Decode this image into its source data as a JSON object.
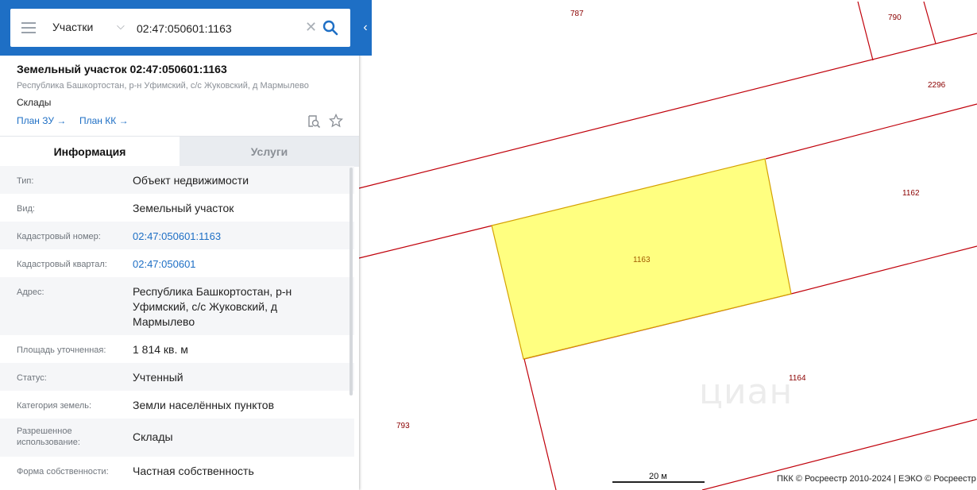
{
  "search": {
    "type_label": "Участки",
    "query": "02:47:050601:1163"
  },
  "object": {
    "title": "Земельный участок 02:47:050601:1163",
    "address": "Республика Башкортостан, р-н Уфимский, с/с Жуковский, д Мармылево",
    "use": "Склады",
    "plan_zu": "План ЗУ →",
    "plan_kk": "План КК →"
  },
  "tabs": {
    "info": "Информация",
    "services": "Услуги"
  },
  "info_rows": [
    {
      "label": "Тип:",
      "value": "Объект недвижимости"
    },
    {
      "label": "Вид:",
      "value": "Земельный участок"
    },
    {
      "label": "Кадастровый номер:",
      "value": "02:47:050601:1163"
    },
    {
      "label": "Кадастровый квартал:",
      "value": "02:47:050601"
    },
    {
      "label": "Адрес:",
      "value": "Республика Башкортостан, р-н Уфимский, с/с Жуковский, д Мармылево"
    },
    {
      "label": "Площадь уточненная:",
      "value": "1 814 кв. м"
    },
    {
      "label": "Статус:",
      "value": "Учтенный"
    },
    {
      "label": "Категория земель:",
      "value": "Земли населённых пунктов"
    },
    {
      "label": "Разрешенное использование:",
      "value": "Склады"
    },
    {
      "label": "Форма собственности:",
      "value": "Частная собственность"
    }
  ],
  "map": {
    "parcels": {
      "p787": "787",
      "p790": "790",
      "p2296": "2296",
      "p1162": "1162",
      "p1163": "1163",
      "p1164": "1164",
      "p793": "793"
    },
    "scale": "20 м",
    "copyright": "ПКК © Росреестр 2010-2024 | ЕЭКО © Росреестр",
    "watermark": "циан"
  },
  "colors": {
    "accent": "#1e6fc5",
    "boundary": "#c0000a",
    "selected_fill": "#ffff80"
  }
}
